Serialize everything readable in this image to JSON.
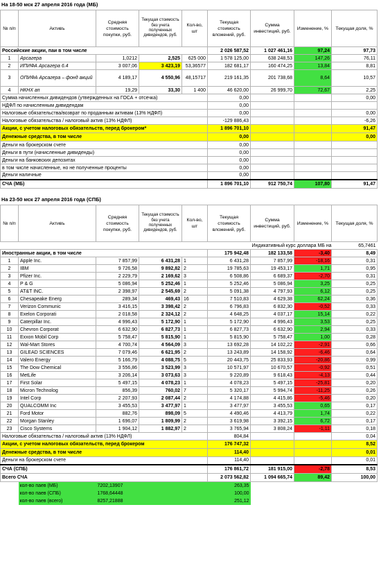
{
  "colors": {
    "green": "#42e042",
    "red": "#ff1f1f",
    "yellow": "#ffff00"
  },
  "headers": {
    "num": "№ п/п",
    "asset": "Активъ",
    "avg_cost": "Средняя стоимость покупки, руб.",
    "cur_cost": "Текущая стоимость без учета полученных дивидендов, руб.",
    "qty": "Кол-во, шт",
    "cur_invest": "Текущая стоимость вложений, руб.",
    "sum_invest": "Сумма инвестиций, руб.",
    "change": "Изменение, %",
    "share": "Текущая доля, %"
  },
  "mb": {
    "title": "На 18-50 мск 27 апреля 2016 года (МБ)",
    "group": {
      "label": "Российские акции, паи в том числе",
      "cur_invest": "2 026 587,52",
      "sum_invest": "1 027 461,16",
      "change": "97,24",
      "share": "97,73"
    },
    "rows": [
      {
        "n": "1",
        "name": "Арсагера",
        "avg": "1,0212",
        "cur": "2,525",
        "qty": "625 000",
        "ci": "1 578 125,00",
        "si": "638 248,53",
        "chg": "147,26",
        "share": "76,11"
      },
      {
        "n": "2",
        "name": "ИПИФА Арсагера 6.4",
        "avg": "3 007,06",
        "cur": "3 423,19",
        "qty": "53,36577",
        "ci": "182 681,17",
        "si": "160 474,25",
        "chg": "13,84",
        "share": "8,81"
      },
      {
        "n": "3",
        "name": "ОПИФА Арсагера – фонд акций",
        "avg": "4 189,17",
        "cur": "4 550,96",
        "qty": "48,15717",
        "ci": "219 161,35",
        "si": "201 738,68",
        "chg": "8,64",
        "share": "10,57"
      },
      {
        "n": "4",
        "name": "НКНХ ап",
        "avg": "19,29",
        "cur": "33,30",
        "qty": "1 400",
        "ci": "46 620,00",
        "si": "26 999,70",
        "chg": "72,67",
        "share": "2,25"
      }
    ],
    "extra": [
      {
        "label": "Сумма начисленных дивидендов (утвержденных на ГОСА + отсечка)",
        "ci": "0,00",
        "share": "0,00"
      },
      {
        "label": "НДФЛ по начисленным дивидендам",
        "ci": "0,00",
        "share": ""
      },
      {
        "label": "Налоговые обязательства/возврат по проданным активам (13% НДФЛ)",
        "ci": "0,00",
        "share": "0,00"
      },
      {
        "label": "Налоговые обязательства / налоговый актив (13% НДФЛ)",
        "ci": "-129 886,43",
        "share": "-6,26"
      }
    ],
    "after_tax": {
      "label": "Акции, с учетом налоговых обязательств, перед брокером*",
      "ci": "1 896 701,10",
      "share": "91,47"
    },
    "cash_group": {
      "label": "Денежные средства, в том числе",
      "ci": "0,00",
      "share": "0,00"
    },
    "cash_rows": [
      {
        "label": "Деньги на брокерском счете",
        "ci": "0,00"
      },
      {
        "label": "Деньги в пути (начисленные дивиденды)",
        "ci": "0,00"
      },
      {
        "label": "Деньги на банковских депозитах",
        "ci": "0,00"
      },
      {
        "label": "в том числе начисленные, но не полученные проценты",
        "ci": "0,00"
      },
      {
        "label": "Деньги наличные",
        "ci": "0,00"
      }
    ],
    "total": {
      "label": "СЧА (МБ)",
      "ci": "1 896 701,10",
      "si": "912 750,74",
      "chg": "107,80",
      "share": "91,47"
    }
  },
  "spb": {
    "title": "На 23-50 мск 27 апреля 2016 года (СПБ)",
    "rate_label": "Индикативный курс доллара МБ на 18-30 мск",
    "rate": "65,7461",
    "group": {
      "label": "Иностранные акции, в том числе",
      "ci": "175 942,48",
      "si": "182 133,58",
      "chg": "-3,40",
      "share": "8,49"
    },
    "rows": [
      {
        "n": "1",
        "name": "Apple Inc.",
        "avg": "7 857,99",
        "cur": "6 431,28",
        "qty": "1",
        "ci": "6 431,28",
        "si": "7 857,99",
        "chg": "-18,16",
        "share": "0,31",
        "col": "red"
      },
      {
        "n": "2",
        "name": "IBM",
        "avg": "9 726,58",
        "cur": "9 892,82",
        "qty": "2",
        "ci": "19 785,63",
        "si": "19 453,17",
        "chg": "1,71",
        "share": "0,95",
        "col": "green"
      },
      {
        "n": "3",
        "name": "Pfizer Inc.",
        "avg": "2 229,79",
        "cur": "2 169,62",
        "qty": "3",
        "ci": "6 508,86",
        "si": "6 689,37",
        "chg": "-2,70",
        "share": "0,31",
        "col": "red"
      },
      {
        "n": "4",
        "name": "P & G",
        "avg": "5 086,94",
        "cur": "5 252,46",
        "qty": "1",
        "ci": "5 252,46",
        "si": "5 086,94",
        "chg": "3,25",
        "share": "0,25",
        "col": "green"
      },
      {
        "n": "5",
        "name": "AT&T INC.",
        "avg": "2 398,97",
        "cur": "2 545,69",
        "qty": "2",
        "ci": "5 091,38",
        "si": "4 797,93",
        "chg": "6,12",
        "share": "0,25",
        "col": "green"
      },
      {
        "n": "6",
        "name": "Chesapeake Energ",
        "avg": "289,34",
        "cur": "469,43",
        "qty": "16",
        "ci": "7 510,83",
        "si": "4 629,38",
        "chg": "62,24",
        "share": "0,36",
        "col": "green"
      },
      {
        "n": "7",
        "name": "Verizon Communic",
        "avg": "3 416,15",
        "cur": "3 398,42",
        "qty": "2",
        "ci": "6 796,83",
        "si": "6 832,30",
        "chg": "-0,52",
        "share": "0,33",
        "col": "red"
      },
      {
        "n": "8",
        "name": "Exelon Corporati",
        "avg": "2 018,58",
        "cur": "2 324,12",
        "qty": "2",
        "ci": "4 648,25",
        "si": "4 037,17",
        "chg": "15,14",
        "share": "0,22",
        "col": "green"
      },
      {
        "n": "9",
        "name": "Caterpillar Inc.",
        "avg": "4 996,43",
        "cur": "5 172,90",
        "qty": "1",
        "ci": "5 172,90",
        "si": "4 996,43",
        "chg": "3,53",
        "share": "0,25",
        "col": "green"
      },
      {
        "n": "10",
        "name": "Chevron Corporat",
        "avg": "6 632,90",
        "cur": "6 827,73",
        "qty": "1",
        "ci": "6 827,73",
        "si": "6 632,90",
        "chg": "2,94",
        "share": "0,33",
        "col": "green"
      },
      {
        "n": "11",
        "name": "Exxon Mobil Corp",
        "avg": "5 758,47",
        "cur": "5 815,90",
        "qty": "1",
        "ci": "5 815,90",
        "si": "5 758,47",
        "chg": "1,00",
        "share": "0,28",
        "col": "green"
      },
      {
        "n": "12",
        "name": "Wal-Mart Stores",
        "avg": "4 700,74",
        "cur": "4 564,09",
        "qty": "3",
        "ci": "13 692,28",
        "si": "14 102,22",
        "chg": "-2,91",
        "share": "0,66",
        "col": "red"
      },
      {
        "n": "13",
        "name": "GILEAD SCIENCES",
        "avg": "7 079,46",
        "cur": "6 621,95",
        "qty": "2",
        "ci": "13 243,89",
        "si": "14 158,92",
        "chg": "-6,46",
        "share": "0,64",
        "col": "red"
      },
      {
        "n": "14",
        "name": "Valero Energy",
        "avg": "5 166,79",
        "cur": "4 088,75",
        "qty": "5",
        "ci": "20 443,75",
        "si": "25 833,93",
        "chg": "-20,86",
        "share": "0,99",
        "col": "red"
      },
      {
        "n": "15",
        "name": "The Dow Chemical",
        "avg": "3 556,86",
        "cur": "3 523,99",
        "qty": "3",
        "ci": "10 571,97",
        "si": "10 670,57",
        "chg": "-0,92",
        "share": "0,51",
        "col": "red"
      },
      {
        "n": "16",
        "name": "MetLife",
        "avg": "3 206,14",
        "cur": "3 073,63",
        "qty": "3",
        "ci": "9 220,89",
        "si": "9 618,43",
        "chg": "-4,13",
        "share": "0,44",
        "col": "red"
      },
      {
        "n": "17",
        "name": "First Solar",
        "avg": "5 497,15",
        "cur": "4 078,23",
        "qty": "1",
        "ci": "4 078,23",
        "si": "5 497,15",
        "chg": "-25,81",
        "share": "0,20",
        "col": "red"
      },
      {
        "n": "18",
        "name": "Micron Technolog",
        "avg": "856,39",
        "cur": "760,02",
        "qty": "7",
        "ci": "5 320,17",
        "si": "5 994,74",
        "chg": "-11,25",
        "share": "0,26",
        "col": "red"
      },
      {
        "n": "19",
        "name": "Intel Corp",
        "avg": "2 207,93",
        "cur": "2 087,44",
        "qty": "2",
        "ci": "4 174,88",
        "si": "4 415,86",
        "chg": "-5,46",
        "share": "0,20",
        "col": "red"
      },
      {
        "n": "20",
        "name": "QUALCOMM Inc",
        "avg": "3 455,53",
        "cur": "3 477,97",
        "qty": "1",
        "ci": "3 477,97",
        "si": "3 455,53",
        "chg": "0,65",
        "share": "0,17",
        "col": "green"
      },
      {
        "n": "21",
        "name": "Ford Motor",
        "avg": "882,76",
        "cur": "898,09",
        "qty": "5",
        "ci": "4 490,46",
        "si": "4 413,79",
        "chg": "1,74",
        "share": "0,22",
        "col": "green"
      },
      {
        "n": "22",
        "name": "Morgan Stanley",
        "avg": "1 696,07",
        "cur": "1 809,99",
        "qty": "2",
        "ci": "3 619,98",
        "si": "3 392,15",
        "chg": "6,72",
        "share": "0,17",
        "col": "green"
      },
      {
        "n": "23",
        "name": "Cisco Systems",
        "avg": "1 904,12",
        "cur": "1 882,97",
        "qty": "2",
        "ci": "3 765,94",
        "si": "3 808,24",
        "chg": "-1,11",
        "share": "0,18",
        "col": "red"
      }
    ],
    "tax": {
      "label": "Налоговые обязательства / налоговый актив (13% НДФЛ)",
      "ci": "804,84",
      "share": "0,04"
    },
    "after_tax": {
      "label": "Акции, с учетом налоговых обязательств, перед брокером",
      "ci": "176 747,32",
      "share": "8,52"
    },
    "cash_group": {
      "label": "Денежные средства, в том числе",
      "ci": "114,40",
      "share": "0,01"
    },
    "cash_row": {
      "label": "Деньги на брокерском счете",
      "ci": "114,40",
      "share": "0,01"
    },
    "total": {
      "label": "СЧА (СПБ)",
      "ci": "176 861,72",
      "si": "181 915,00",
      "chg": "-2,78",
      "share": "8,53"
    },
    "grand": {
      "label": "Всего СЧА",
      "ci": "2 073 562,82",
      "si": "1 094 665,74",
      "chg": "89,42",
      "share": "100,00"
    }
  },
  "units": [
    {
      "label": "кол-во паев (МБ)",
      "qty": "7202,13907",
      "value": "263,35"
    },
    {
      "label": "кол-во паев (СПБ)",
      "qty": "1768,64448",
      "value": "100,00"
    },
    {
      "label": "кол-во паев (всего)",
      "qty": "8257,21888",
      "value": "251,12"
    }
  ]
}
